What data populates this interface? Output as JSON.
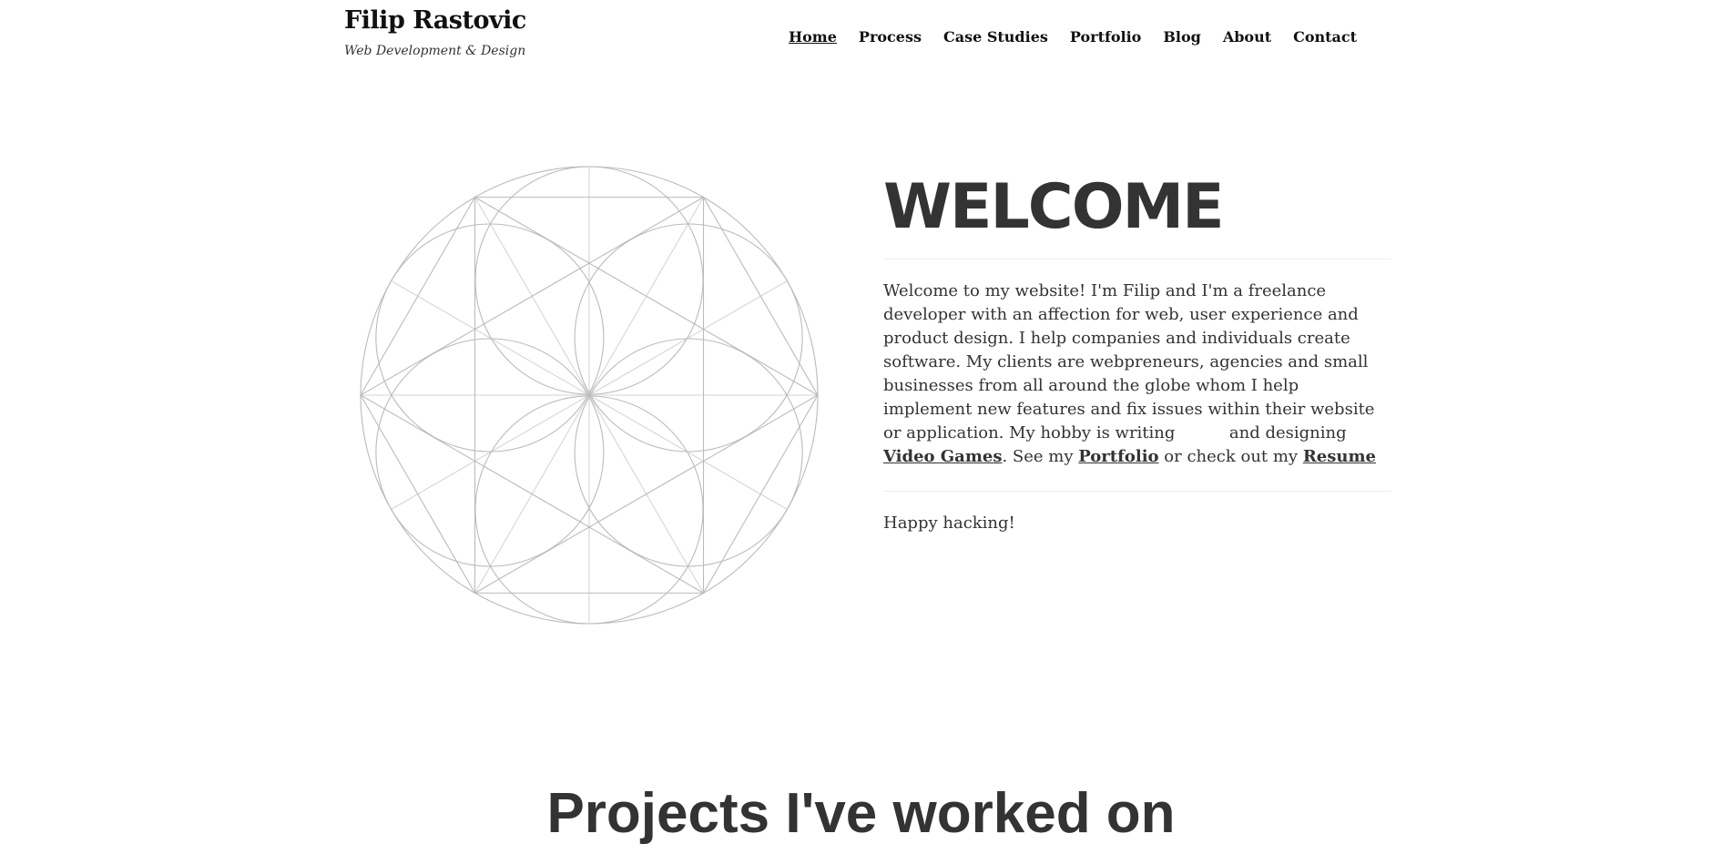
{
  "header": {
    "site_title": "Filip Rastovic",
    "tagline": "Web Development & Design"
  },
  "nav": {
    "items": [
      {
        "label": "Home",
        "active": true
      },
      {
        "label": "Process",
        "active": false
      },
      {
        "label": "Case Studies",
        "active": false
      },
      {
        "label": "Portfolio",
        "active": false
      },
      {
        "label": "Blog",
        "active": false
      },
      {
        "label": "About",
        "active": false
      },
      {
        "label": "Contact",
        "active": false
      }
    ]
  },
  "hero": {
    "illustration": "flower-of-life-geometry",
    "line_color": "#bbbbbb"
  },
  "welcome": {
    "title": "WELCOME",
    "text_part1": "Welcome to my website! I'm Filip and I'm a freelance developer with an affection for web, user experience and product design. I help companies and individuals create software. My clients are webpreneurs, agencies and small businesses from all around the globe whom I help implement new features and fix issues within their website or application. My hobby is writing",
    "text_part2": "and designing",
    "link_video_games": "Video Games",
    "text_part3": ". See my",
    "link_portfolio": "Portfolio",
    "text_part4": "or check out my",
    "link_resume": "Resume",
    "closing": "Happy hacking!"
  },
  "projects": {
    "title": "Projects I've worked on"
  },
  "colors": {
    "text": "#333333",
    "heading": "#111111",
    "rule": "#eeeeee",
    "background": "#ffffff"
  }
}
